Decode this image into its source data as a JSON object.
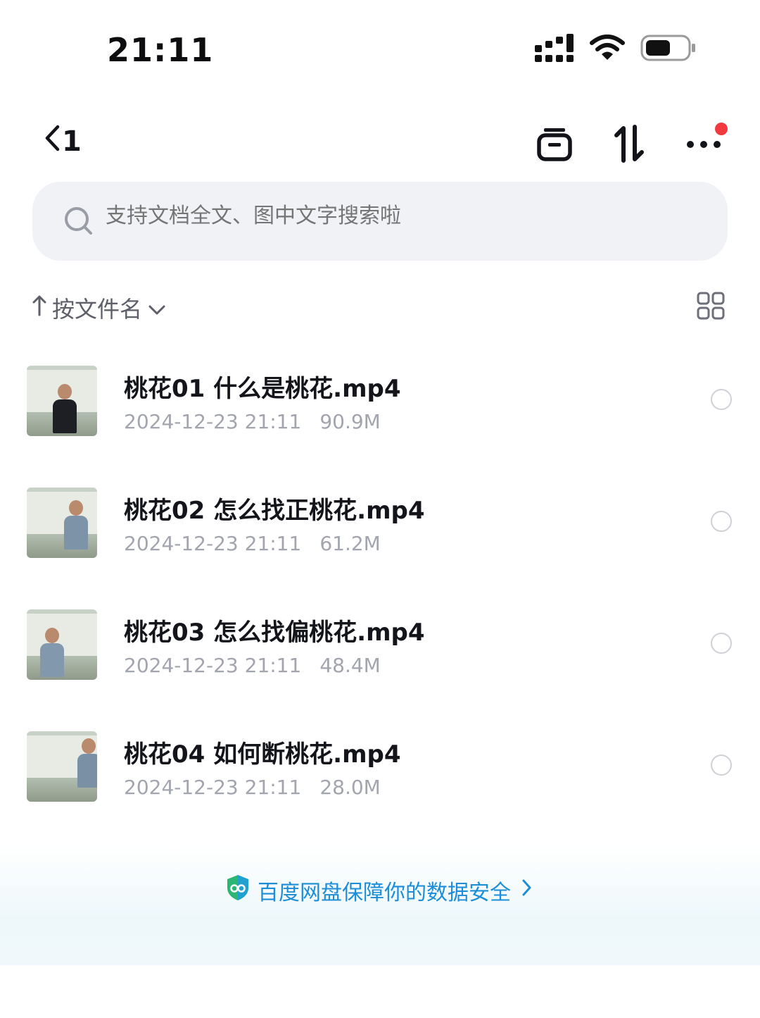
{
  "status_bar": {
    "time": "21:11"
  },
  "nav": {
    "back_label": "1"
  },
  "search": {
    "placeholder": "支持文档全文、图中文字搜索啦"
  },
  "sort": {
    "label": "按文件名"
  },
  "files": [
    {
      "name": "桃花01 什么是桃花.mp4",
      "date": "2024-12-23 21:11",
      "size": "90.9M"
    },
    {
      "name": "桃花02 怎么找正桃花.mp4",
      "date": "2024-12-23 21:11",
      "size": "61.2M"
    },
    {
      "name": "桃花03 怎么找偏桃花.mp4",
      "date": "2024-12-23 21:11",
      "size": "48.4M"
    },
    {
      "name": "桃花04 如何断桃花.mp4",
      "date": "2024-12-23 21:11",
      "size": "28.0M"
    }
  ],
  "footer": {
    "security_text": "百度网盘保障你的数据安全"
  },
  "colors": {
    "accent": "#1c8ed8",
    "notification": "#f13a3f"
  }
}
